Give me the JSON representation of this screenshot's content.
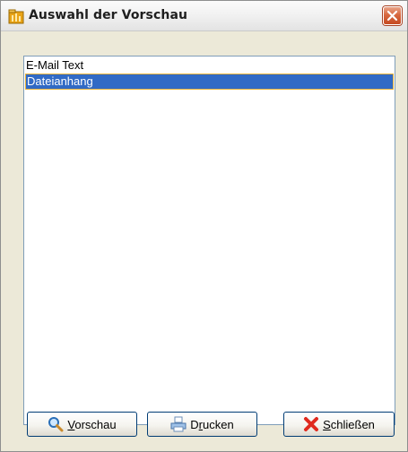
{
  "window": {
    "title": "Auswahl der Vorschau",
    "title_icon": "folder-app-icon",
    "close_icon": "close-icon"
  },
  "list": {
    "items": [
      {
        "label": "E-Mail Text",
        "selected": false
      },
      {
        "label": "Dateianhang",
        "selected": true
      }
    ],
    "selection_color": "#316ac5"
  },
  "buttons": {
    "preview": {
      "icon": "magnifier-icon",
      "label_pre": "",
      "hotkey": "V",
      "label_post": "orschau"
    },
    "print": {
      "icon": "printer-icon",
      "label_pre": "D",
      "hotkey": "r",
      "label_post": "ucken"
    },
    "close": {
      "icon": "red-x-icon",
      "label_pre": "",
      "hotkey": "S",
      "label_post": "chließen"
    }
  }
}
